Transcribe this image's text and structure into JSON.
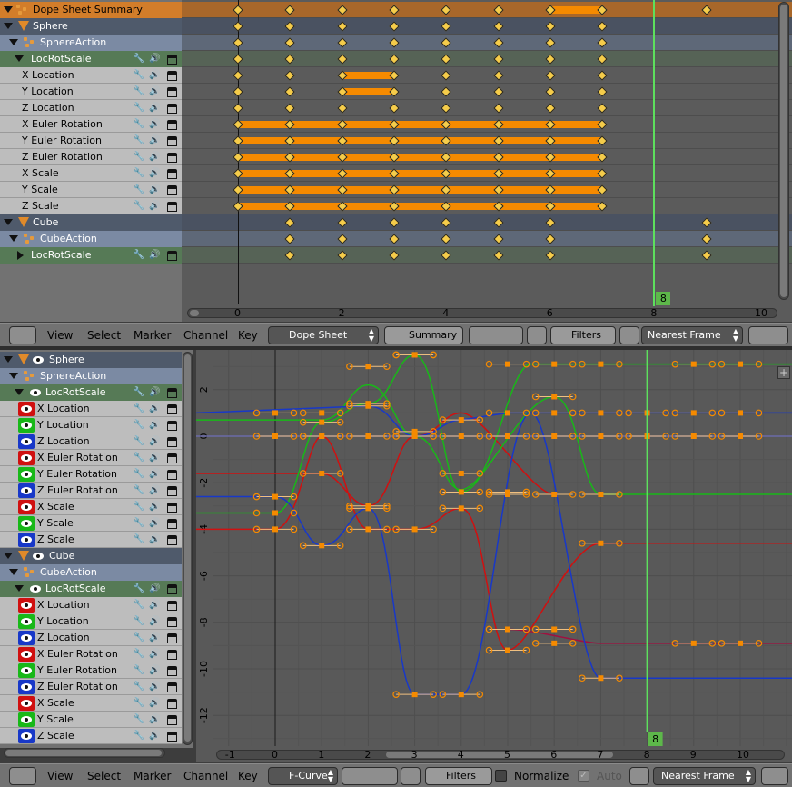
{
  "dopesheet": {
    "rows": [
      {
        "type": "summary",
        "label": "Dope Sheet Summary"
      },
      {
        "type": "object",
        "label": "Sphere"
      },
      {
        "type": "action",
        "label": "SphereAction"
      },
      {
        "type": "group",
        "label": "LocRotScale"
      },
      {
        "type": "chan",
        "label": "X Location"
      },
      {
        "type": "chan",
        "label": "Y Location"
      },
      {
        "type": "chan",
        "label": "Z Location"
      },
      {
        "type": "chan",
        "label": "X Euler Rotation"
      },
      {
        "type": "chan",
        "label": "Y Euler Rotation"
      },
      {
        "type": "chan",
        "label": "Z Euler Rotation"
      },
      {
        "type": "chan",
        "label": "X Scale"
      },
      {
        "type": "chan",
        "label": "Y Scale"
      },
      {
        "type": "chan",
        "label": "Z Scale"
      },
      {
        "type": "object",
        "label": "Cube"
      },
      {
        "type": "action",
        "label": "CubeAction"
      },
      {
        "type": "group",
        "label": "LocRotScale",
        "collapsed": true
      }
    ],
    "ruler": [
      "0",
      "2",
      "4",
      "6",
      "8",
      "10"
    ],
    "current_frame": "8",
    "keyframes": {
      "sphere_frames": [
        0,
        1,
        2,
        3,
        4,
        5,
        6,
        7
      ],
      "cube_frames": [
        1,
        2,
        3,
        4,
        5,
        6,
        9
      ]
    }
  },
  "dopesheet_header": {
    "menus": [
      "View",
      "Select",
      "Marker",
      "Channel",
      "Key"
    ],
    "mode": "Dope Sheet",
    "summary_btn": "Summary",
    "filters": "Filters",
    "snap": "Nearest Frame"
  },
  "graph": {
    "rows": [
      {
        "type": "object",
        "label": "Sphere"
      },
      {
        "type": "action",
        "label": "SphereAction"
      },
      {
        "type": "group",
        "label": "LocRotScale"
      },
      {
        "type": "chan",
        "label": "X Location",
        "color": "#d01010"
      },
      {
        "type": "chan",
        "label": "Y Location",
        "color": "#18b818"
      },
      {
        "type": "chan",
        "label": "Z Location",
        "color": "#1838c8"
      },
      {
        "type": "chan",
        "label": "X Euler Rotation",
        "color": "#d01010"
      },
      {
        "type": "chan",
        "label": "Y Euler Rotation",
        "color": "#18b818"
      },
      {
        "type": "chan",
        "label": "Z Euler Rotation",
        "color": "#1838c8"
      },
      {
        "type": "chan",
        "label": "X Scale",
        "color": "#d01010"
      },
      {
        "type": "chan",
        "label": "Y Scale",
        "color": "#18b818"
      },
      {
        "type": "chan",
        "label": "Z Scale",
        "color": "#1838c8"
      },
      {
        "type": "object",
        "label": "Cube"
      },
      {
        "type": "action",
        "label": "CubeAction"
      },
      {
        "type": "group",
        "label": "LocRotScale"
      },
      {
        "type": "chan",
        "label": "X Location",
        "color": "#d01010"
      },
      {
        "type": "chan",
        "label": "Y Location",
        "color": "#18b818"
      },
      {
        "type": "chan",
        "label": "Z Location",
        "color": "#1838c8"
      },
      {
        "type": "chan",
        "label": "X Euler Rotation",
        "color": "#d01010"
      },
      {
        "type": "chan",
        "label": "Y Euler Rotation",
        "color": "#18b818"
      },
      {
        "type": "chan",
        "label": "Z Euler Rotation",
        "color": "#1838c8"
      },
      {
        "type": "chan",
        "label": "X Scale",
        "color": "#d01010"
      },
      {
        "type": "chan",
        "label": "Y Scale",
        "color": "#18b818"
      },
      {
        "type": "chan",
        "label": "Z Scale",
        "color": "#1838c8"
      }
    ],
    "x_ticks": [
      "-1",
      "0",
      "1",
      "2",
      "3",
      "4",
      "5",
      "6",
      "7",
      "8",
      "9",
      "10"
    ],
    "y_ticks": [
      "2",
      "0",
      "-2",
      "-4",
      "-6",
      "-8",
      "-10",
      "-12"
    ],
    "current_frame": "8"
  },
  "graph_header": {
    "menus": [
      "View",
      "Select",
      "Marker",
      "Channel",
      "Key"
    ],
    "mode": "F-Curve",
    "filters": "Filters",
    "normalize": "Normalize",
    "auto": "Auto",
    "snap": "Nearest Frame"
  },
  "colors": {
    "x": "#d01010",
    "y": "#18b818",
    "z": "#1838c8",
    "key": "#f58a00",
    "frame": "#5de05d"
  }
}
